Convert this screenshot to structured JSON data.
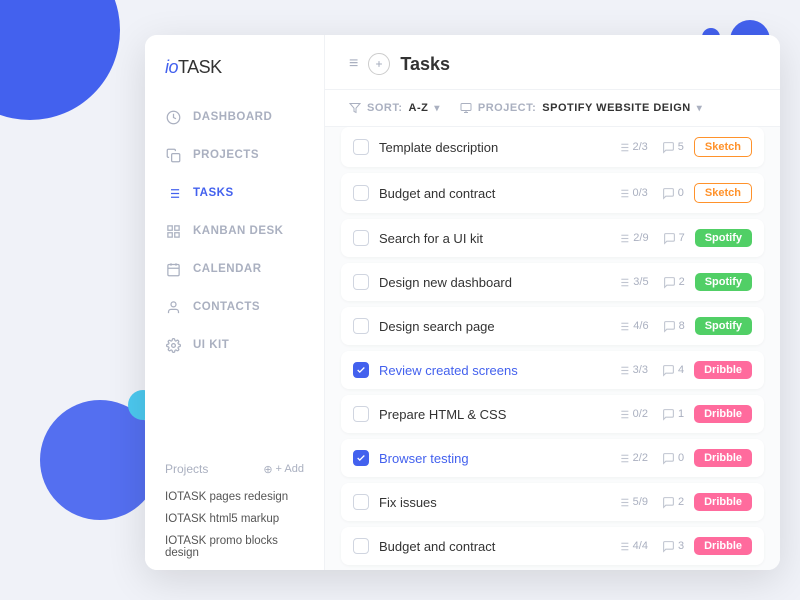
{
  "app": {
    "logo": "ioTASK",
    "logo_io": "io",
    "logo_task": "TASK"
  },
  "sidebar": {
    "nav_items": [
      {
        "id": "dashboard",
        "label": "DASHBOARD",
        "icon": "clock"
      },
      {
        "id": "projects",
        "label": "PROJECTS",
        "icon": "copy"
      },
      {
        "id": "tasks",
        "label": "TASKS",
        "icon": "list",
        "active": true
      },
      {
        "id": "kanban",
        "label": "KANBAN DESK",
        "icon": "grid"
      },
      {
        "id": "calendar",
        "label": "CALENDAR",
        "icon": "calendar"
      },
      {
        "id": "contacts",
        "label": "CONTACTS",
        "icon": "contacts"
      },
      {
        "id": "uikit",
        "label": "UI KIT",
        "icon": "gear"
      }
    ],
    "projects_label": "Projects",
    "add_label": "+ Add",
    "projects": [
      {
        "name": "IOTASK pages redesign"
      },
      {
        "name": "IOTASK html5 markup"
      },
      {
        "name": "IOTASK promo blocks design"
      }
    ]
  },
  "header": {
    "title": "Tasks",
    "menu_icon": "≡",
    "add_icon": "+"
  },
  "filter": {
    "sort_label": "SORT:",
    "sort_value": "A-Z",
    "project_label": "PROJECT:",
    "project_value": "SPOTIFY WEBSITE DEIGN"
  },
  "tasks": [
    {
      "id": 1,
      "name": "Template description",
      "subtasks": "2/3",
      "comments": "5",
      "tag": "Sketch",
      "tag_style": "sketch-outline",
      "checked": false
    },
    {
      "id": 2,
      "name": "Budget and contract",
      "subtasks": "0/3",
      "comments": "0",
      "tag": "Sketch",
      "tag_style": "sketch-outline",
      "checked": false
    },
    {
      "id": 3,
      "name": "Search for a UI kit",
      "subtasks": "2/9",
      "comments": "7",
      "tag": "Spotify",
      "tag_style": "spotify",
      "checked": false
    },
    {
      "id": 4,
      "name": "Design new dashboard",
      "subtasks": "3/5",
      "comments": "2",
      "tag": "Spotify",
      "tag_style": "spotify",
      "checked": false
    },
    {
      "id": 5,
      "name": "Design search page",
      "subtasks": "4/6",
      "comments": "8",
      "tag": "Spotify",
      "tag_style": "spotify",
      "checked": false
    },
    {
      "id": 6,
      "name": "Review created screens",
      "subtasks": "3/3",
      "comments": "4",
      "tag": "Dribble",
      "tag_style": "dribble",
      "checked": true
    },
    {
      "id": 7,
      "name": "Prepare HTML & CSS",
      "subtasks": "0/2",
      "comments": "1",
      "tag": "Dribble",
      "tag_style": "dribble",
      "checked": false
    },
    {
      "id": 8,
      "name": "Browser testing",
      "subtasks": "2/2",
      "comments": "0",
      "tag": "Dribble",
      "tag_style": "dribble",
      "checked": true
    },
    {
      "id": 9,
      "name": "Fix issues",
      "subtasks": "5/9",
      "comments": "2",
      "tag": "Dribble",
      "tag_style": "dribble",
      "checked": false
    },
    {
      "id": 10,
      "name": "Budget and contract",
      "subtasks": "4/4",
      "comments": "3",
      "tag": "Dribble",
      "tag_style": "dribble",
      "checked": false
    }
  ]
}
